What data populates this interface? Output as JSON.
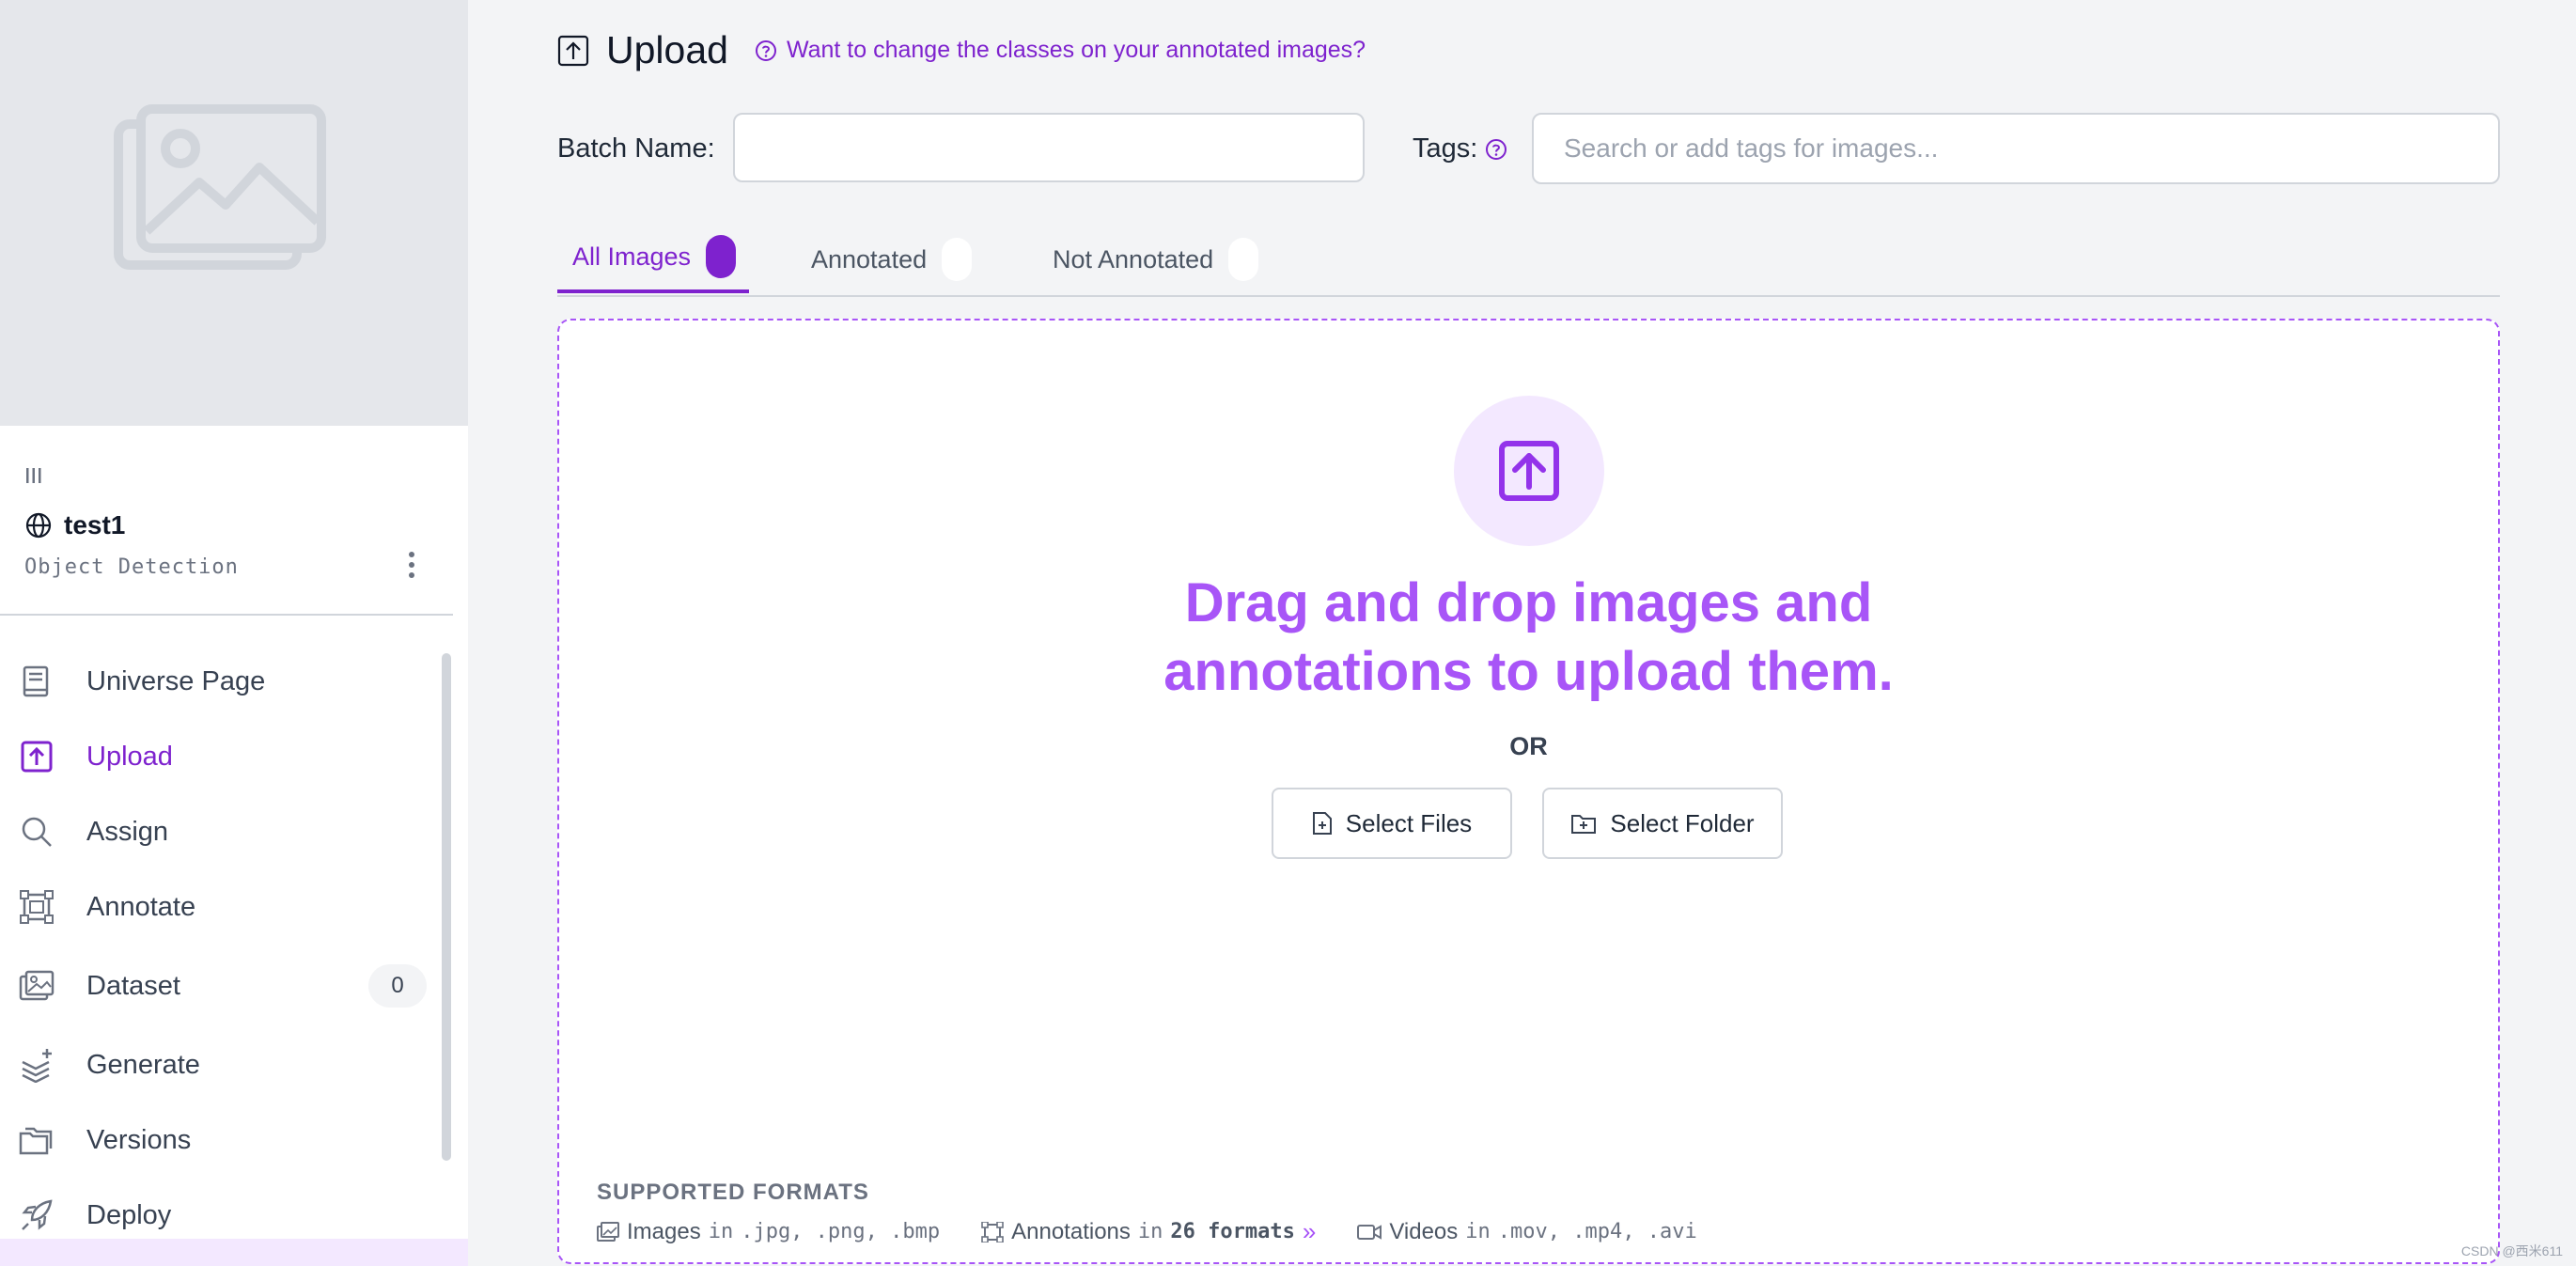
{
  "sidebar": {
    "project_name": "test1",
    "project_type": "Object Detection",
    "nav": [
      {
        "label": "Universe Page",
        "icon": "book-icon"
      },
      {
        "label": "Upload",
        "icon": "upload-icon",
        "active": true
      },
      {
        "label": "Assign",
        "icon": "search-icon"
      },
      {
        "label": "Annotate",
        "icon": "annotate-icon"
      },
      {
        "label": "Dataset",
        "icon": "images-icon",
        "badge": "0"
      },
      {
        "label": "Generate",
        "icon": "layers-icon"
      },
      {
        "label": "Versions",
        "icon": "folders-icon"
      },
      {
        "label": "Deploy",
        "icon": "rocket-icon"
      }
    ]
  },
  "header": {
    "title": "Upload",
    "help_link": "Want to change the classes on your annotated images?"
  },
  "form": {
    "batch_label": "Batch Name:",
    "batch_value": "",
    "tags_label": "Tags:",
    "tags_placeholder": "Search or add tags for images..."
  },
  "tabs": [
    {
      "label": "All Images",
      "active": true
    },
    {
      "label": "Annotated"
    },
    {
      "label": "Not Annotated"
    }
  ],
  "dropzone": {
    "title_line1": "Drag and drop images and",
    "title_line2": "annotations to upload them.",
    "or": "OR",
    "select_files": "Select Files",
    "select_folder": "Select Folder"
  },
  "formats": {
    "title": "SUPPORTED FORMATS",
    "images_label": "Images",
    "images_in": "in",
    "images_types": ".jpg, .png, .bmp",
    "annotations_label": "Annotations",
    "annotations_in": "in",
    "annotations_count": "26 formats",
    "annotations_more": "»",
    "videos_label": "Videos",
    "videos_in": "in",
    "videos_types": ".mov, .mp4, .avi"
  },
  "watermark": "CSDN @西米611",
  "colors": {
    "accent": "#7e22ce",
    "accent_light": "#a855f7",
    "accent_bg": "#f3e8ff"
  }
}
